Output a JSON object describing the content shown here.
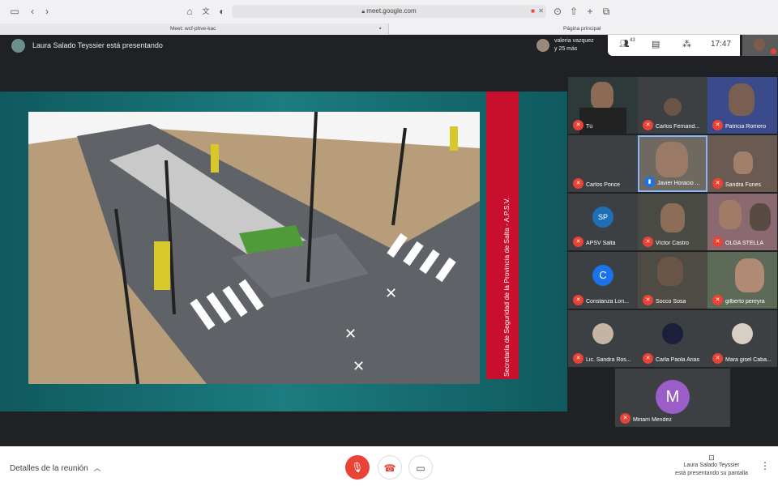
{
  "browser": {
    "url": "meet.google.com",
    "tabs": [
      {
        "label": "Meet: wcf-phve-kac"
      },
      {
        "label": "Página principal"
      }
    ]
  },
  "meet_header": {
    "presenter_label": "Laura Salado Teyssier está presentando",
    "viewer_name": "valeria vazquez",
    "viewer_more": "y 25 más",
    "participant_count": "43",
    "time": "17:47"
  },
  "slide": {
    "banner_text": "Secretaría de Seguridad de la Provincia de Salta - A.P.S.V."
  },
  "participants": [
    {
      "name": "Tú",
      "type": "video"
    },
    {
      "name": "Carlos Fernand...",
      "type": "video"
    },
    {
      "name": "Patricia Romero",
      "type": "video"
    },
    {
      "name": "Carlos Ponce",
      "type": "blank"
    },
    {
      "name": "Javier Horacio ...",
      "type": "video"
    },
    {
      "name": "Sandra Funes",
      "type": "video"
    },
    {
      "name": "APSV Salta",
      "type": "logo"
    },
    {
      "name": "Víctor Castro",
      "type": "video"
    },
    {
      "name": "OLGA STELLA",
      "type": "video"
    },
    {
      "name": "Constanza Lon...",
      "type": "avatar",
      "initial": "C"
    },
    {
      "name": "Socco Sosa",
      "type": "video"
    },
    {
      "name": "gilberto pereyra",
      "type": "video"
    },
    {
      "name": "Lic. Sandra Ros...",
      "type": "small"
    },
    {
      "name": "Carla Paola Arias",
      "type": "small"
    },
    {
      "name": "Mara gisel Caba...",
      "type": "small"
    },
    {
      "name": "Miriam Mendez",
      "type": "avatar",
      "initial": "M"
    }
  ],
  "bottom_bar": {
    "details_label": "Detalles de la reunión",
    "presenting_name": "Laura Salado Teyssier",
    "presenting_status": "está presentando su pantalla"
  },
  "colors": {
    "meet_bg": "#202124",
    "mic_off": "#ea4335",
    "banner": "#c8102e",
    "teal": "#1c7c7f"
  }
}
